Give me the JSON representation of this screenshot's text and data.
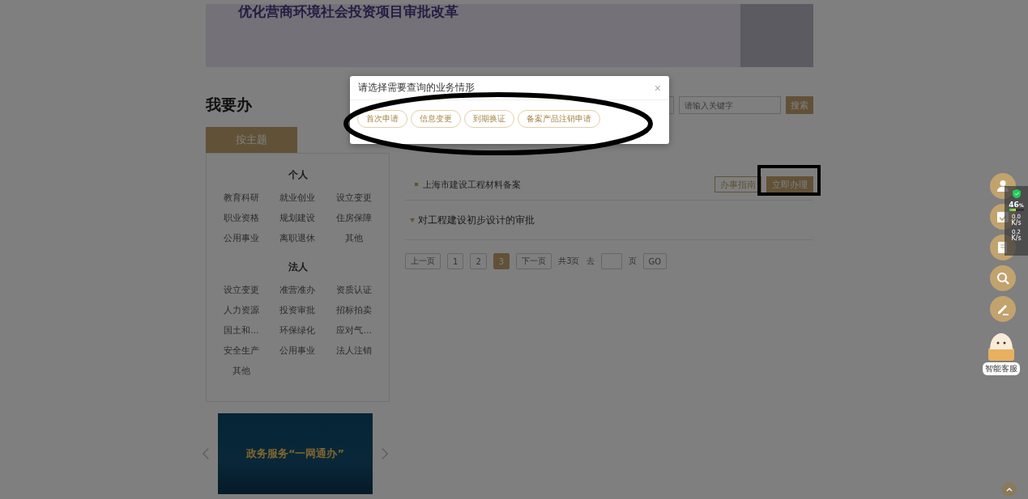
{
  "banner": {
    "title": "优化营商环境社会投资项目审批改革"
  },
  "section_title": "我要办",
  "search": {
    "placeholder": "请输入关键字",
    "button": "搜索"
  },
  "tabs": [
    {
      "label": "按主题",
      "selected": true
    }
  ],
  "categories": [
    {
      "heading": "个人",
      "items": [
        "教育科研",
        "就业创业",
        "设立变更",
        "职业资格",
        "规划建设",
        "住房保障",
        "公用事业",
        "离职退休",
        "其他"
      ]
    },
    {
      "heading": "法人",
      "items": [
        "设立变更",
        "准营准办",
        "资质认证",
        "人力资源",
        "投资审批",
        "招标拍卖",
        "国土和...",
        "环保绿化",
        "应对气...",
        "安全生产",
        "公用事业",
        "法人注销",
        "其他"
      ]
    }
  ],
  "items": [
    {
      "kind": "entry",
      "title": "上海市建设工程材料备案",
      "buttons": [
        "办事指南",
        "立即办理"
      ]
    },
    {
      "kind": "group",
      "title": "对工程建设初步设计的审批"
    }
  ],
  "pagination": {
    "prev": "上一页",
    "pages": [
      {
        "label": "1",
        "selected": false
      },
      {
        "label": "2",
        "selected": false
      },
      {
        "label": "3",
        "selected": true
      }
    ],
    "next": "下一页",
    "total": "共3页",
    "goto": "去",
    "unit": "页",
    "go": "GO"
  },
  "carousel": {
    "caption": "政务服务“一网通办”"
  },
  "assistant": {
    "label": "智能客服"
  },
  "net_widget": {
    "percent": "46",
    "percent_unit": "%",
    "level": 0.46,
    "up": {
      "value": "0.0",
      "unit": "K/s"
    },
    "down": {
      "value": "0.2",
      "unit": "K/s"
    }
  },
  "modal": {
    "title": "请选择需要查询的业务情形",
    "close": "×",
    "options": [
      "首次申请",
      "信息变更",
      "到期换证",
      "备案产品注销申请"
    ]
  }
}
